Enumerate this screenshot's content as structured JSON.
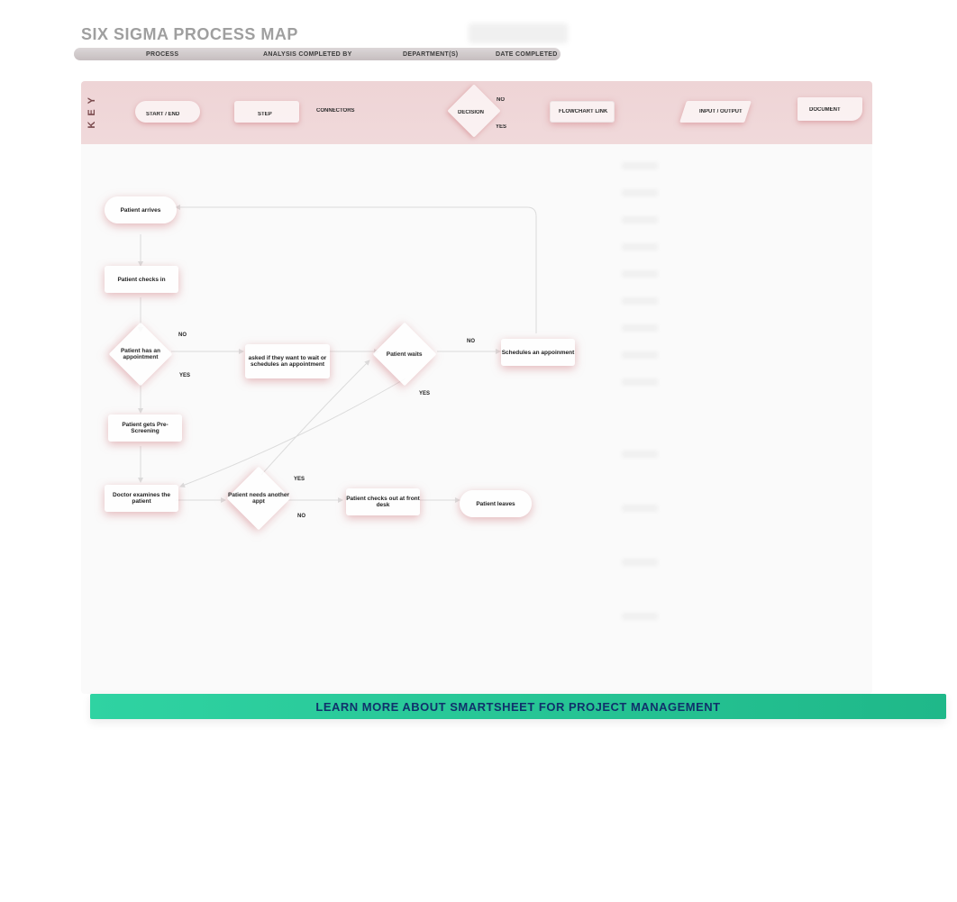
{
  "title": "SIX SIGMA PROCESS MAP",
  "meta": {
    "process": "PROCESS",
    "analysis": "ANALYSIS COMPLETED BY",
    "department": "DEPARTMENT(S)",
    "date": "DATE COMPLETED"
  },
  "key": {
    "label": "KEY",
    "start_end": "START / END",
    "step": "STEP",
    "connectors": "CONNECTORS",
    "decision": "DECISION",
    "decision_no": "NO",
    "decision_yes": "YES",
    "flowchart_link": "FLOWCHART LINK",
    "input_output": "INPUT / OUTPUT",
    "document": "DOCUMENT"
  },
  "nodes": {
    "arrives": "Patient arrives",
    "checks_in": "Patient checks in",
    "has_appt": "Patient has an appointment",
    "has_appt_no": "NO",
    "has_appt_yes": "YES",
    "asked_wait": "asked if they want to wait or schedules an appointment",
    "waits": "Patient waits",
    "waits_no": "NO",
    "waits_yes": "YES",
    "schedules": "Schedules an appoinment",
    "prescreen": "Patient gets Pre-Screening",
    "doctor": "Doctor examines the patient",
    "needs_appt": "Patient needs another appt",
    "needs_yes": "YES",
    "needs_no": "NO",
    "checkout": "Patient checks out at front desk",
    "leaves": "Patient leaves"
  },
  "footer": "LEARN MORE ABOUT SMARTSHEET FOR PROJECT MANAGEMENT",
  "colors": {
    "pink": "#d68489",
    "green": "#24c193",
    "navy": "#10316b"
  }
}
